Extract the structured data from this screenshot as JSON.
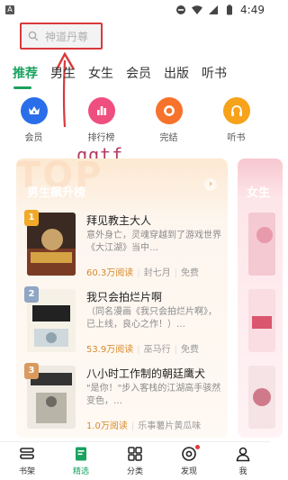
{
  "status_bar": {
    "left_icon": "A",
    "time": "4:49"
  },
  "search": {
    "placeholder": "神道丹尊"
  },
  "annotation": {
    "text": "qqtf"
  },
  "tabs": [
    {
      "label": "推荐",
      "active": true
    },
    {
      "label": "男生"
    },
    {
      "label": "女生"
    },
    {
      "label": "会员"
    },
    {
      "label": "出版"
    },
    {
      "label": "听书"
    }
  ],
  "categories": [
    {
      "label": "会员",
      "icon": "crown-icon",
      "color": "#2a6ee9"
    },
    {
      "label": "排行榜",
      "icon": "bar-chart-icon",
      "color": "#ef4f7f"
    },
    {
      "label": "完结",
      "icon": "circle-icon",
      "color": "#f7722a"
    },
    {
      "label": "听书",
      "icon": "headphones-icon",
      "color": "#f7a21b"
    }
  ],
  "ranking": {
    "bg_text": "TOP",
    "title": "男生飙升榜",
    "books": [
      {
        "rank": "1",
        "title": "拜见教主大人",
        "desc": "意外身亡，灵魂穿越到了游戏世界《大江湖》当中…",
        "reads": "60.3万阅读",
        "author": "封七月",
        "price": "免费"
      },
      {
        "rank": "2",
        "title": "我只会拍烂片啊",
        "desc": "（同名漫画《我只会拍烂片啊》，已上线，良心之作！）…",
        "reads": "53.9万阅读",
        "author": "巫马行",
        "price": "免费"
      },
      {
        "rank": "3",
        "title": "八小时工作制的朝廷鹰犬",
        "desc": "\"是你！\"步入客栈的江湖高手骇然变色，…",
        "reads": "1.0万阅读",
        "author": "乐事薯片黄瓜味",
        "price": ""
      }
    ]
  },
  "ranking2": {
    "title": "女生"
  },
  "bottom_nav": [
    {
      "label": "书架",
      "icon": "bookshelf-icon"
    },
    {
      "label": "精选",
      "icon": "featured-icon",
      "active": true
    },
    {
      "label": "分类",
      "icon": "category-grid-icon"
    },
    {
      "label": "发现",
      "icon": "discover-icon"
    },
    {
      "label": "我",
      "icon": "user-icon"
    }
  ],
  "colors": {
    "accent": "#1aa260",
    "annotation": "#d9383a"
  }
}
